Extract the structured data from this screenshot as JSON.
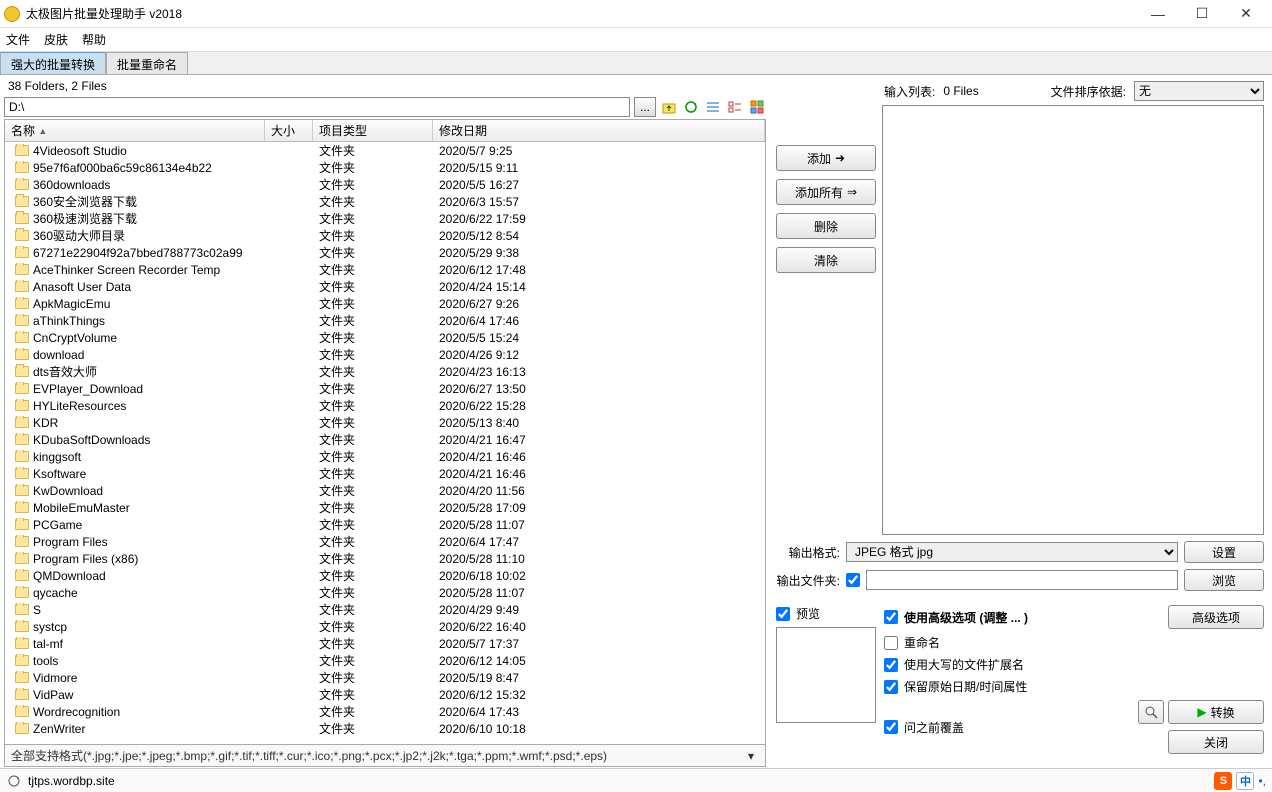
{
  "window": {
    "title": "太极图片批量处理助手  v2018"
  },
  "menu": {
    "file": "文件",
    "skin": "皮肤",
    "help": "帮助"
  },
  "tabs": {
    "convert": "强大的批量转换",
    "rename": "批量重命名"
  },
  "status": "38 Folders, 2 Files",
  "path": {
    "value": "D:\\",
    "dots": "..."
  },
  "columns": {
    "name": "名称",
    "size": "大小",
    "type": "项目类型",
    "date": "修改日期"
  },
  "file_type": "文件夹",
  "rows": [
    {
      "n": "4Videosoft Studio",
      "d": "2020/5/7 9:25"
    },
    {
      "n": "95e7f6af000ba6c59c86134e4b22",
      "d": "2020/5/15 9:11"
    },
    {
      "n": "360downloads",
      "d": "2020/5/5 16:27"
    },
    {
      "n": "360安全浏览器下载",
      "d": "2020/6/3 15:57"
    },
    {
      "n": "360极速浏览器下载",
      "d": "2020/6/22 17:59"
    },
    {
      "n": "360驱动大师目录",
      "d": "2020/5/12 8:54"
    },
    {
      "n": "67271e22904f92a7bbed788773c02a99",
      "d": "2020/5/29 9:38"
    },
    {
      "n": "AceThinker Screen Recorder Temp",
      "d": "2020/6/12 17:48"
    },
    {
      "n": "Anasoft User Data",
      "d": "2020/4/24 15:14"
    },
    {
      "n": "ApkMagicEmu",
      "d": "2020/6/27 9:26"
    },
    {
      "n": "aThinkThings",
      "d": "2020/6/4 17:46"
    },
    {
      "n": "CnCryptVolume",
      "d": "2020/5/5 15:24"
    },
    {
      "n": "download",
      "d": "2020/4/26 9:12"
    },
    {
      "n": "dts音效大师",
      "d": "2020/4/23 16:13"
    },
    {
      "n": "EVPlayer_Download",
      "d": "2020/6/27 13:50"
    },
    {
      "n": "HYLiteResources",
      "d": "2020/6/22 15:28"
    },
    {
      "n": "KDR",
      "d": "2020/5/13 8:40"
    },
    {
      "n": "KDubaSoftDownloads",
      "d": "2020/4/21 16:47"
    },
    {
      "n": "kinggsoft",
      "d": "2020/4/21 16:46"
    },
    {
      "n": "Ksoftware",
      "d": "2020/4/21 16:46"
    },
    {
      "n": "KwDownload",
      "d": "2020/4/20 11:56"
    },
    {
      "n": "MobileEmuMaster",
      "d": "2020/5/28 17:09"
    },
    {
      "n": "PCGame",
      "d": "2020/5/28 11:07"
    },
    {
      "n": "Program Files",
      "d": "2020/6/4 17:47"
    },
    {
      "n": "Program Files (x86)",
      "d": "2020/5/28 11:10"
    },
    {
      "n": "QMDownload",
      "d": "2020/6/18 10:02"
    },
    {
      "n": "qycache",
      "d": "2020/5/28 11:07"
    },
    {
      "n": "S",
      "d": "2020/4/29 9:49"
    },
    {
      "n": "systcp",
      "d": "2020/6/22 16:40"
    },
    {
      "n": "tal-mf",
      "d": "2020/5/7 17:37"
    },
    {
      "n": "tools",
      "d": "2020/6/12 14:05"
    },
    {
      "n": "Vidmore",
      "d": "2020/5/19 8:47"
    },
    {
      "n": "VidPaw",
      "d": "2020/6/12 15:32"
    },
    {
      "n": "Wordrecognition",
      "d": "2020/6/4 17:43"
    },
    {
      "n": "ZenWriter",
      "d": "2020/6/10 10:18"
    }
  ],
  "formats": "全部支持格式(*.jpg;*.jpe;*.jpeg;*.bmp;*.gif;*.tif;*.tiff;*.cur;*.ico;*.png;*.pcx;*.jp2;*.j2k;*.tga;*.ppm;*.wmf;*.psd;*.eps)",
  "right": {
    "input_list_label": "输入列表:",
    "input_list_count": "0 Files",
    "sort_label": "文件排序依据:",
    "sort_value": "无",
    "btn_add": "添加",
    "btn_add_all": "添加所有",
    "btn_delete": "删除",
    "btn_clear": "清除",
    "out_format_label": "输出格式:",
    "out_format_value": "JPEG 格式 jpg",
    "btn_settings": "设置",
    "out_folder_label": "输出文件夹:",
    "btn_browse": "浏览",
    "preview": "预览",
    "adv_options": "使用高级选项  (调整 ... )",
    "btn_adv": "高级选项",
    "chk_rename": "重命名",
    "chk_upper_ext": "使用大写的文件扩展名",
    "chk_keep_date": "保留原始日期/时间属性",
    "chk_ask_overwrite": "问之前覆盖",
    "btn_convert": "转换",
    "btn_close": "关闭"
  },
  "statusbar": {
    "url": "tjtps.wordbp.site",
    "ime": "中"
  }
}
